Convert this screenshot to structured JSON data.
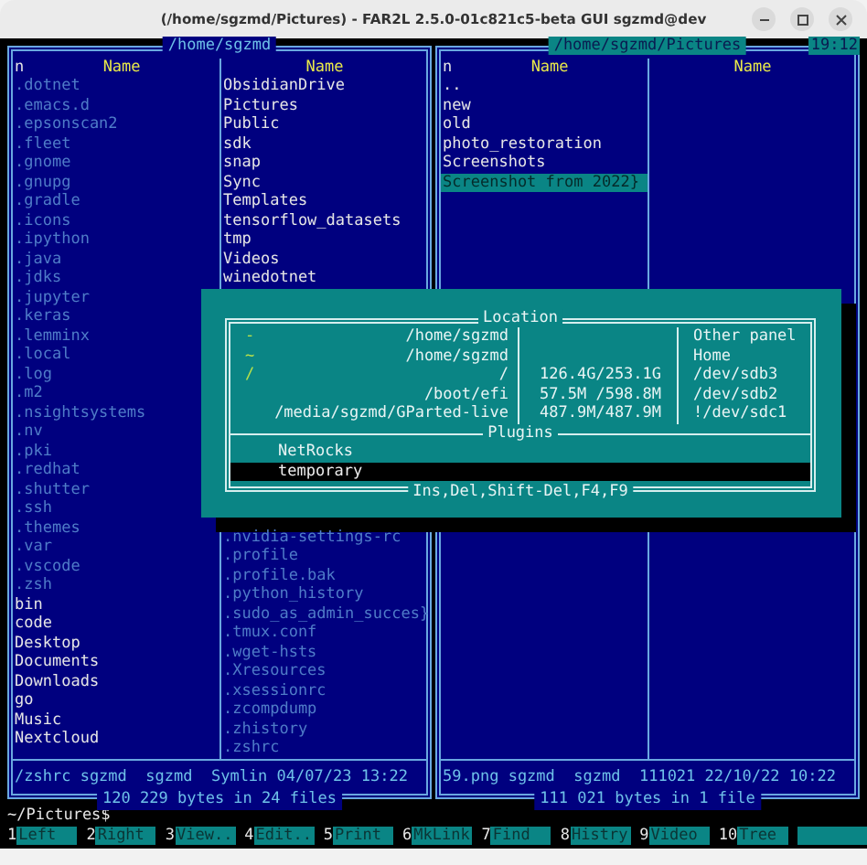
{
  "window": {
    "title": "(/home/sgzmd/Pictures) - FAR2L 2.5.0-01c821c5-beta GUI sgzmd@dev"
  },
  "panels": [
    {
      "path": "/home/sgzmd",
      "active": false,
      "columns": [
        {
          "sort_mark": "n",
          "header": "Name",
          "files": [
            {
              "name": ".dotnet",
              "hidden": true,
              "selected": false
            },
            {
              "name": ".emacs.d",
              "hidden": true,
              "selected": false
            },
            {
              "name": ".epsonscan2",
              "hidden": true,
              "selected": false
            },
            {
              "name": ".fleet",
              "hidden": true,
              "selected": false
            },
            {
              "name": ".gnome",
              "hidden": true,
              "selected": false
            },
            {
              "name": ".gnupg",
              "hidden": true,
              "selected": false
            },
            {
              "name": ".gradle",
              "hidden": true,
              "selected": false
            },
            {
              "name": ".icons",
              "hidden": true,
              "selected": false
            },
            {
              "name": ".ipython",
              "hidden": true,
              "selected": false
            },
            {
              "name": ".java",
              "hidden": true,
              "selected": false
            },
            {
              "name": ".jdks",
              "hidden": true,
              "selected": false
            },
            {
              "name": ".jupyter",
              "hidden": true,
              "selected": false
            },
            {
              "name": ".keras",
              "hidden": true,
              "selected": false
            },
            {
              "name": ".lemminx",
              "hidden": true,
              "selected": false
            },
            {
              "name": ".local",
              "hidden": true,
              "selected": false
            },
            {
              "name": ".log",
              "hidden": true,
              "selected": false
            },
            {
              "name": ".m2",
              "hidden": true,
              "selected": false
            },
            {
              "name": ".nsightsystems",
              "hidden": true,
              "selected": false
            },
            {
              "name": ".nv",
              "hidden": true,
              "selected": false
            },
            {
              "name": ".pki",
              "hidden": true,
              "selected": false
            },
            {
              "name": ".redhat",
              "hidden": true,
              "selected": false
            },
            {
              "name": ".shutter",
              "hidden": true,
              "selected": false
            },
            {
              "name": ".ssh",
              "hidden": true,
              "selected": false
            },
            {
              "name": ".themes",
              "hidden": true,
              "selected": false
            },
            {
              "name": ".var",
              "hidden": true,
              "selected": false
            },
            {
              "name": ".vscode",
              "hidden": true,
              "selected": false
            },
            {
              "name": ".zsh",
              "hidden": true,
              "selected": false
            },
            {
              "name": "bin",
              "hidden": false,
              "selected": false
            },
            {
              "name": "code",
              "hidden": false,
              "selected": false
            },
            {
              "name": "Desktop",
              "hidden": false,
              "selected": false
            },
            {
              "name": "Documents",
              "hidden": false,
              "selected": false
            },
            {
              "name": "Downloads",
              "hidden": false,
              "selected": false
            },
            {
              "name": "go",
              "hidden": false,
              "selected": false
            },
            {
              "name": "Music",
              "hidden": false,
              "selected": false
            },
            {
              "name": "Nextcloud",
              "hidden": false,
              "selected": false
            }
          ]
        },
        {
          "header": "Name",
          "files": [
            {
              "name": "ObsidianDrive",
              "hidden": false,
              "selected": false
            },
            {
              "name": "Pictures",
              "hidden": false,
              "selected": false
            },
            {
              "name": "Public",
              "hidden": false,
              "selected": false
            },
            {
              "name": "sdk",
              "hidden": false,
              "selected": false
            },
            {
              "name": "snap",
              "hidden": false,
              "selected": false
            },
            {
              "name": "Sync",
              "hidden": false,
              "selected": false
            },
            {
              "name": "Templates",
              "hidden": false,
              "selected": false
            },
            {
              "name": "tensorflow_datasets",
              "hidden": false,
              "selected": false
            },
            {
              "name": "tmp",
              "hidden": false,
              "selected": false
            },
            {
              "name": "Videos",
              "hidden": false,
              "selected": false
            },
            {
              "name": "winedotnet",
              "hidden": false,
              "selected": false
            }
          ],
          "files_bottom": [
            {
              "name": ".nvidia-settings-rc",
              "hidden": true,
              "selected": false
            },
            {
              "name": ".profile",
              "hidden": true,
              "selected": false
            },
            {
              "name": ".profile.bak",
              "hidden": true,
              "selected": false
            },
            {
              "name": ".python_history",
              "hidden": true,
              "selected": false
            },
            {
              "name": ".sudo_as_admin_succes}",
              "hidden": true,
              "selected": false
            },
            {
              "name": ".tmux.conf",
              "hidden": true,
              "selected": false
            },
            {
              "name": ".wget-hsts",
              "hidden": true,
              "selected": false
            },
            {
              "name": ".Xresources",
              "hidden": true,
              "selected": false
            },
            {
              "name": ".xsessionrc",
              "hidden": true,
              "selected": false
            },
            {
              "name": ".zcompdump",
              "hidden": true,
              "selected": false
            },
            {
              "name": ".zhistory",
              "hidden": true,
              "selected": false
            },
            {
              "name": ".zshrc",
              "hidden": true,
              "selected": false
            }
          ]
        }
      ],
      "status": "/zshrc sgzmd  sgzmd  Symlin 04/07/23 13:22",
      "summary": "120 229 bytes in 24 files"
    },
    {
      "path": "/home/sgzmd/Pictures",
      "active": true,
      "clock": "19:12",
      "columns": [
        {
          "sort_mark": "n",
          "header": "Name",
          "files": [
            {
              "name": "..",
              "hidden": false,
              "selected": false
            },
            {
              "name": "new",
              "hidden": false,
              "selected": false
            },
            {
              "name": "old",
              "hidden": false,
              "selected": false
            },
            {
              "name": "photo_restoration",
              "hidden": false,
              "selected": false
            },
            {
              "name": "Screenshots",
              "hidden": false,
              "selected": false
            },
            {
              "name": "Screenshot from 2022}",
              "hidden": false,
              "selected": true
            }
          ]
        },
        {
          "header": "Name"
        }
      ],
      "status": "59.png sgzmd  sgzmd  111021 22/10/22 10:22",
      "summary": "111 021 bytes in 1 file"
    }
  ],
  "dialog": {
    "title": "Location",
    "locations": [
      {
        "marker": "-",
        "path": "/home/sgzmd",
        "device": "Other panel"
      },
      {
        "marker": "~",
        "path": "/home/sgzmd",
        "device": "Home"
      },
      {
        "marker": "/",
        "path": "/",
        "usage": "126.4G/253.1G",
        "device": "/dev/sdb3"
      },
      {
        "path": "/boot/efi",
        "usage": "57.5M /598.8M",
        "device": "/dev/sdb2"
      },
      {
        "path": "/media/sgzmd/GParted-live",
        "usage": "487.9M/487.9M",
        "device": "!/dev/sdc1"
      }
    ],
    "plugins_title": "Plugins",
    "plugins": [
      {
        "name": "NetRocks",
        "selected": false
      },
      {
        "name": "temporary",
        "selected": true
      }
    ],
    "hint": "Ins,Del,Shift-Del,F4,F9"
  },
  "command_line": "~/Pictures$",
  "keybar": [
    {
      "key": "1",
      "label": "Left"
    },
    {
      "key": "2",
      "label": "Right"
    },
    {
      "key": "3",
      "label": "View.."
    },
    {
      "key": "4",
      "label": "Edit.."
    },
    {
      "key": "5",
      "label": "Print"
    },
    {
      "key": "6",
      "label": "MkLink"
    },
    {
      "key": "7",
      "label": "Find"
    },
    {
      "key": "8",
      "label": "Histry"
    },
    {
      "key": "9",
      "label": "Video"
    },
    {
      "key": "10",
      "label": "Tree"
    }
  ]
}
